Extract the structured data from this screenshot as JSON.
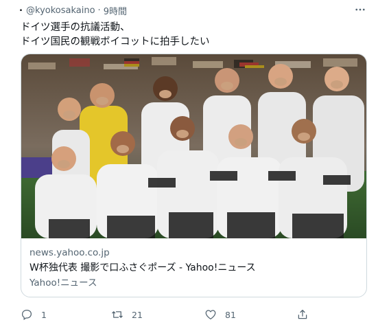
{
  "tweet": {
    "author_mark": ".",
    "handle": "@kyokosakaino",
    "separator": "·",
    "time": "9時間",
    "text_line1": "ドイツ選手の抗議活動、",
    "text_line2": "ドイツ国民の観戦ボイコットに拍手したい"
  },
  "card": {
    "image_icon": "team-photo-image",
    "domain": "news.yahoo.co.jp",
    "title": "W杯独代表 撮影で口ふさぐポーズ - Yahoo!ニュース",
    "source": "Yahoo!ニュース"
  },
  "actions": {
    "reply_icon": "reply-icon",
    "reply_count": "1",
    "retweet_icon": "retweet-icon",
    "retweet_count": "21",
    "like_icon": "heart-icon",
    "like_count": "81",
    "share_icon": "share-icon"
  },
  "colors": {
    "text_primary": "#0f1419",
    "text_secondary": "#536471",
    "border": "#cfd9de"
  }
}
